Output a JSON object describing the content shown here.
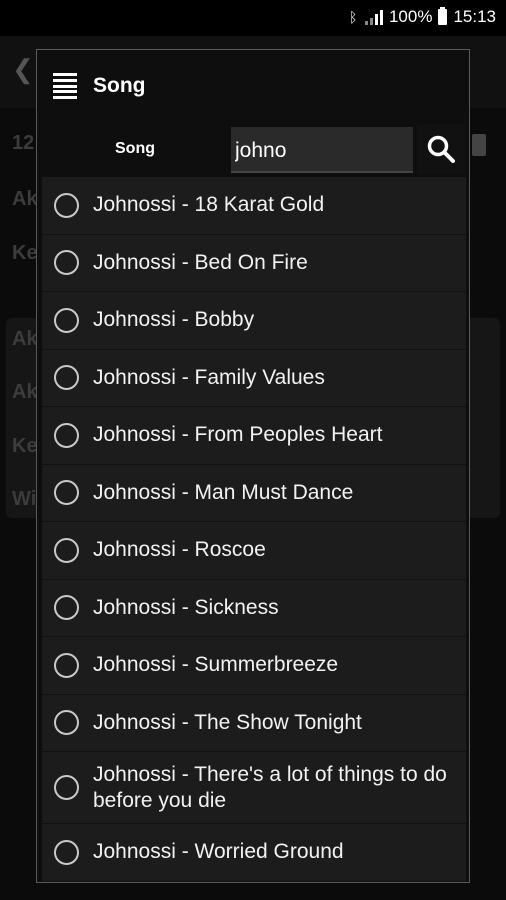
{
  "status_bar": {
    "battery": "100%",
    "time": "15:13"
  },
  "background": {
    "back_glyph": "❮",
    "rows": [
      "12",
      "Ak",
      "Ke"
    ],
    "card_rows": [
      "Ak",
      "Ak",
      "Ke",
      "Wi"
    ]
  },
  "dialog": {
    "title": "Song",
    "search": {
      "label": "Song",
      "value": "johno"
    },
    "items": [
      "Johnossi - 18 Karat Gold",
      "Johnossi - Bed On Fire",
      "Johnossi - Bobby",
      "Johnossi - Family Values",
      "Johnossi - From Peoples Heart",
      "Johnossi - Man Must Dance",
      "Johnossi - Roscoe",
      "Johnossi - Sickness",
      "Johnossi - Summerbreeze",
      "Johnossi - The Show Tonight",
      "Johnossi - There's a lot of things to do before you die",
      "Johnossi - Worried Ground"
    ]
  }
}
